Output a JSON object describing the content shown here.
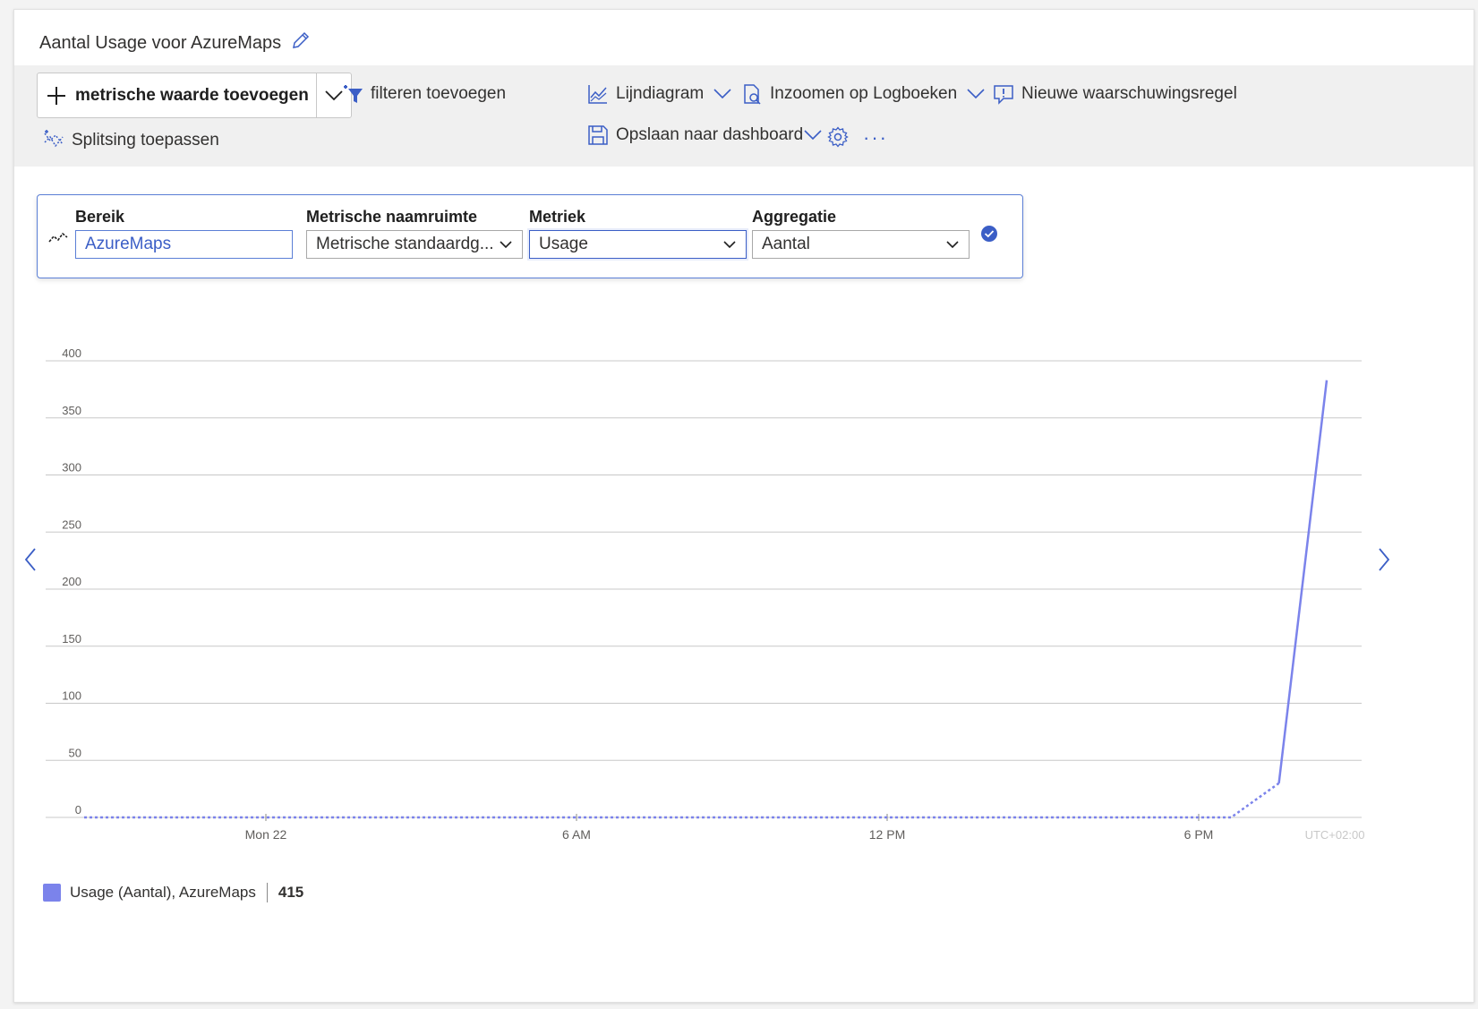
{
  "header": {
    "title": "Aantal Usage voor AzureMaps"
  },
  "toolbar": {
    "add_metric": "metrische waarde toevoegen",
    "add_filter": "filteren toevoegen",
    "apply_splitting": "Splitsing toepassen",
    "line_chart": "Lijndiagram",
    "drill_logs": "Inzoomen op Logboeken",
    "new_alert": "Nieuwe waarschuwingsregel",
    "save_dashboard": "Opslaan naar dashboard",
    "more": "···"
  },
  "selector": {
    "scope_label": "Bereik",
    "scope_value": "AzureMaps",
    "namespace_label": "Metrische naamruimte",
    "namespace_value": "Metrische standaardg...",
    "metric_label": "Metriek",
    "metric_value": "Usage",
    "aggregation_label": "Aggregatie",
    "aggregation_value": "Aantal"
  },
  "legend": {
    "label": "Usage (Aantal), AzureMaps",
    "value": "415"
  },
  "colors": {
    "accent": "#3b5ec6",
    "series": "#7b83eb",
    "grid": "#c8c8c8"
  },
  "chart_data": {
    "type": "line",
    "ylim": [
      0,
      400
    ],
    "yticks": [
      "400",
      "350",
      "300",
      "250",
      "200",
      "150",
      "100",
      "50",
      "0"
    ],
    "xticks": [
      "Mon 22",
      "6 AM",
      "12 PM",
      "6 PM"
    ],
    "timezone_label": "UTC+02:00",
    "series": [
      {
        "name": "Usage (Aantal), AzureMaps",
        "values": [
          0,
          0,
          0,
          0,
          0,
          0,
          0,
          0,
          0,
          0,
          0,
          0,
          0,
          0,
          0,
          0,
          0,
          0,
          0,
          0,
          0,
          0,
          0,
          0,
          0,
          30,
          383
        ]
      }
    ]
  }
}
